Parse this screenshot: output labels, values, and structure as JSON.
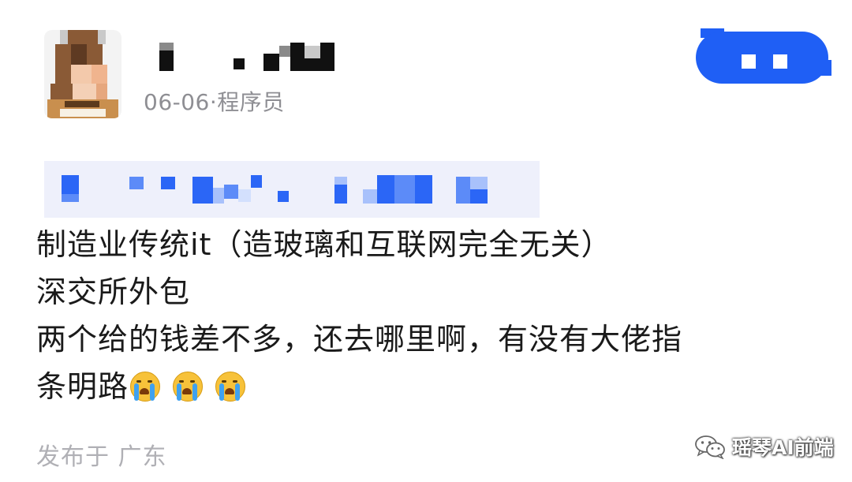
{
  "post": {
    "author": {
      "avatar": "pixelated-avatar",
      "name_masked": true
    },
    "date": "06-06",
    "separator": "·",
    "occupation": "程序员",
    "follow_button_masked": true,
    "title_masked": true,
    "body_lines": [
      "制造业传统it（造玻璃和互联网完全无关）",
      "深交所外包",
      "两个给的钱差不多，还去哪里啊，有没有大佬指",
      "条明路"
    ],
    "emoji": "loudly-crying-face",
    "emoji_count": 3,
    "location_prefix": "发布于",
    "location": "广东"
  },
  "watermark": {
    "icon": "wechat-icon",
    "text": "瑶琴AI前端"
  },
  "colors": {
    "accent": "#1f5ff5",
    "meta_text": "#8e8e93",
    "body_text": "#1a1a1a",
    "location_text": "#b0b0b5"
  }
}
